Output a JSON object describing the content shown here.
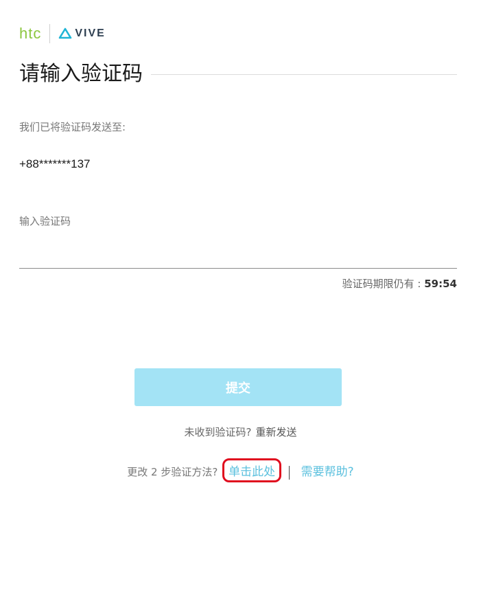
{
  "brand": {
    "htc": "htc",
    "vive": "VIVE"
  },
  "title": "请输入验证码",
  "sent_label": "我们已将验证码发送至:",
  "phone": "+88*******137",
  "code_input": {
    "placeholder": "输入验证码",
    "value": ""
  },
  "expiry": {
    "label": "验证码期限仍有 : ",
    "time": "59:54"
  },
  "submit_label": "提交",
  "resend": {
    "question": "未收到验证码?",
    "link": "重新发送"
  },
  "method": {
    "question": "更改 2 步验证方法?",
    "click_here": "单击此处",
    "help": "需要帮助?"
  },
  "colors": {
    "htc_green": "#8cc63f",
    "accent_blue": "#5bc0de",
    "button_bg": "#a3e3f5",
    "highlight_red": "#e00b1e"
  }
}
